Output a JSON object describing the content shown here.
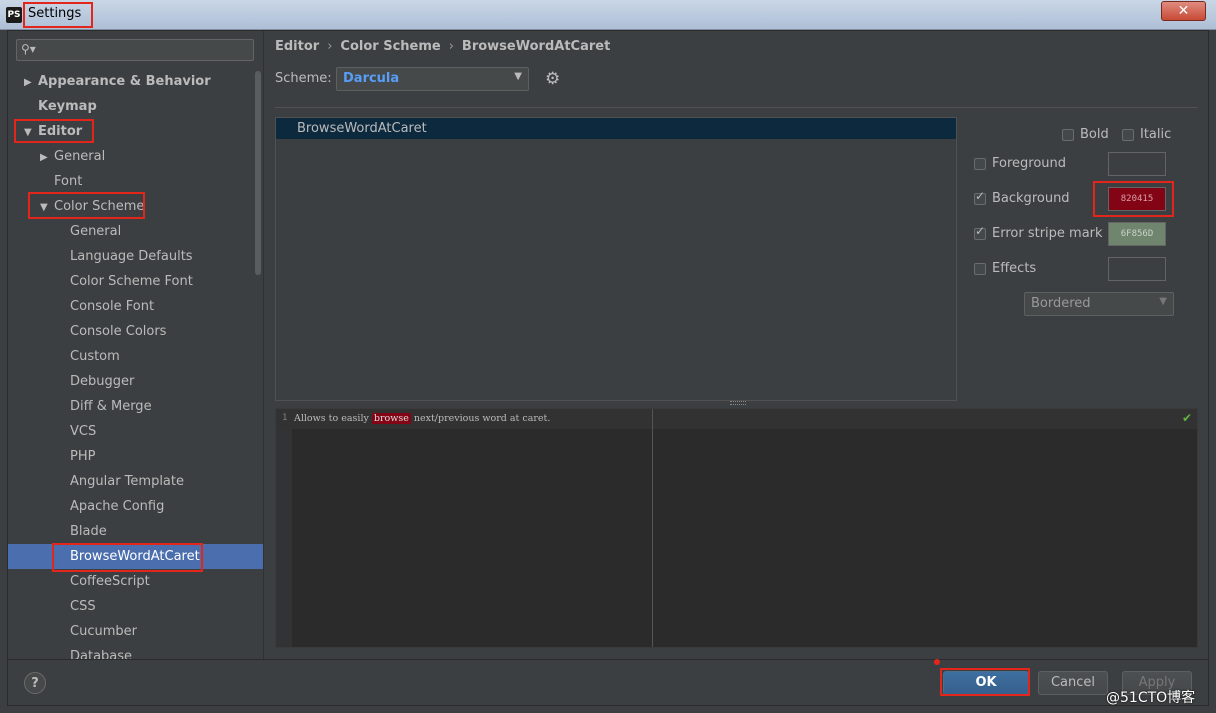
{
  "window": {
    "title": "Settings",
    "app_icon": "PS",
    "close_glyph": "✕"
  },
  "search": {
    "placeholder": "",
    "icon": "magnifier-icon"
  },
  "tree": [
    {
      "label": "Appearance & Behavior",
      "indent": 0,
      "arrow": "right",
      "bold": true
    },
    {
      "label": "Keymap",
      "indent": 0,
      "arrow": "none",
      "bold": true
    },
    {
      "label": "Editor",
      "indent": 0,
      "arrow": "down",
      "bold": true
    },
    {
      "label": "General",
      "indent": 1,
      "arrow": "right"
    },
    {
      "label": "Font",
      "indent": 1,
      "arrow": "none"
    },
    {
      "label": "Color Scheme",
      "indent": 1,
      "arrow": "down"
    },
    {
      "label": "General",
      "indent": 2,
      "arrow": "none"
    },
    {
      "label": "Language Defaults",
      "indent": 2,
      "arrow": "none"
    },
    {
      "label": "Color Scheme Font",
      "indent": 2,
      "arrow": "none"
    },
    {
      "label": "Console Font",
      "indent": 2,
      "arrow": "none"
    },
    {
      "label": "Console Colors",
      "indent": 2,
      "arrow": "none"
    },
    {
      "label": "Custom",
      "indent": 2,
      "arrow": "none"
    },
    {
      "label": "Debugger",
      "indent": 2,
      "arrow": "none"
    },
    {
      "label": "Diff & Merge",
      "indent": 2,
      "arrow": "none"
    },
    {
      "label": "VCS",
      "indent": 2,
      "arrow": "none"
    },
    {
      "label": "PHP",
      "indent": 2,
      "arrow": "none"
    },
    {
      "label": "Angular Template",
      "indent": 2,
      "arrow": "none"
    },
    {
      "label": "Apache Config",
      "indent": 2,
      "arrow": "none"
    },
    {
      "label": "Blade",
      "indent": 2,
      "arrow": "none"
    },
    {
      "label": "BrowseWordAtCaret",
      "indent": 2,
      "arrow": "none",
      "selected": true
    },
    {
      "label": "CoffeeScript",
      "indent": 2,
      "arrow": "none"
    },
    {
      "label": "CSS",
      "indent": 2,
      "arrow": "none"
    },
    {
      "label": "Cucumber",
      "indent": 2,
      "arrow": "none"
    },
    {
      "label": "Database",
      "indent": 2,
      "arrow": "none"
    }
  ],
  "breadcrumb": {
    "part1": "Editor",
    "part2": "Color Scheme",
    "part3": "BrowseWordAtCaret",
    "sep": "›"
  },
  "scheme": {
    "label": "Scheme:",
    "value": "Darcula"
  },
  "attributes": {
    "selected_item": "BrowseWordAtCaret"
  },
  "options": {
    "bold": {
      "label": "Bold",
      "checked": false
    },
    "italic": {
      "label": "Italic",
      "checked": false
    },
    "foreground": {
      "label": "Foreground",
      "checked": false,
      "color": ""
    },
    "background": {
      "label": "Background",
      "checked": true,
      "color": "820415"
    },
    "error_stripe": {
      "label": "Error stripe mark",
      "checked": true,
      "color": "6F856D"
    },
    "effects": {
      "label": "Effects",
      "checked": false,
      "color": ""
    },
    "effects_type": "Bordered"
  },
  "preview": {
    "line_number": "1",
    "before": "Allows to easily ",
    "highlight": "browse",
    "after": " next/previous word at caret."
  },
  "footer": {
    "help": "?",
    "ok": "OK",
    "cancel": "Cancel",
    "apply": "Apply"
  },
  "watermark": "@51CTO博客",
  "colors": {
    "selection": "#4b6eaf",
    "background_swatch": "#820415",
    "error_stripe_swatch": "#6F856D",
    "annotation": "#e3261b"
  }
}
